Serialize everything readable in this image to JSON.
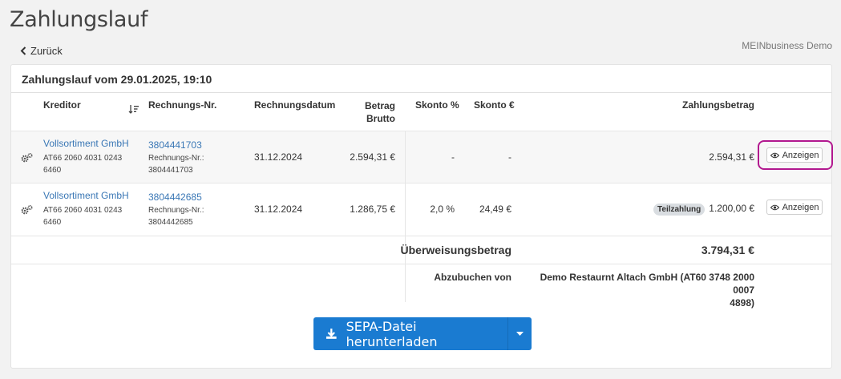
{
  "page": {
    "title": "Zahlungslauf",
    "back_label": "Zurück",
    "company": "MEINbusiness Demo"
  },
  "panel": {
    "title": "Zahlungslauf vom 29.01.2025, 19:10"
  },
  "table": {
    "headers": {
      "kreditor": "Kreditor",
      "rechnungs_nr": "Rechnungs-Nr.",
      "rechnungsdatum": "Rechnungsdatum",
      "betrag_line1": "Betrag",
      "betrag_line2": "Brutto",
      "skonto_pct": "Skonto %",
      "skonto_eur": "Skonto €",
      "zahlungsbetrag": "Zahlungsbetrag"
    },
    "rows": [
      {
        "kreditor": "Vollsortiment GmbH",
        "iban_line1": "AT66 2060 4031 0243",
        "iban_line2": "6460",
        "rechnungs_nr": "3804441703",
        "rechnungs_nr_label": "Rechnungs-Nr.:",
        "rechnungs_nr_sub": "3804441703",
        "datum": "31.12.2024",
        "betrag": "2.594,31 €",
        "skonto_pct": "-",
        "skonto_eur": "-",
        "badge": "",
        "zahlungsbetrag": "2.594,31 €",
        "action": "Anzeigen"
      },
      {
        "kreditor": "Vollsortiment GmbH",
        "iban_line1": "AT66 2060 4031 0243",
        "iban_line2": "6460",
        "rechnungs_nr": "3804442685",
        "rechnungs_nr_label": "Rechnungs-Nr.:",
        "rechnungs_nr_sub": "3804442685",
        "datum": "31.12.2024",
        "betrag": "1.286,75 €",
        "skonto_pct": "2,0 %",
        "skonto_eur": "24,49 €",
        "badge": "Teilzahlung",
        "zahlungsbetrag": "1.200,00 €",
        "action": "Anzeigen"
      }
    ],
    "summary": {
      "label": "Überweisungsbetrag",
      "value": "3.794,31 €"
    },
    "abzubuchen": {
      "label": "Abzubuchen von",
      "line1": "Demo Restaurnt Altach GmbH (AT60 3748 2000 0007",
      "line2": "4898)"
    }
  },
  "actions": {
    "sepa_label": "SEPA-Datei herunterladen"
  },
  "colors": {
    "link": "#3a77b5",
    "primary": "#1a7bd1",
    "highlight": "#b2188f"
  },
  "icons": [
    "chevron-left-icon",
    "sort-icon",
    "gears-icon",
    "eye-icon",
    "download-icon",
    "caret-down-icon"
  ]
}
